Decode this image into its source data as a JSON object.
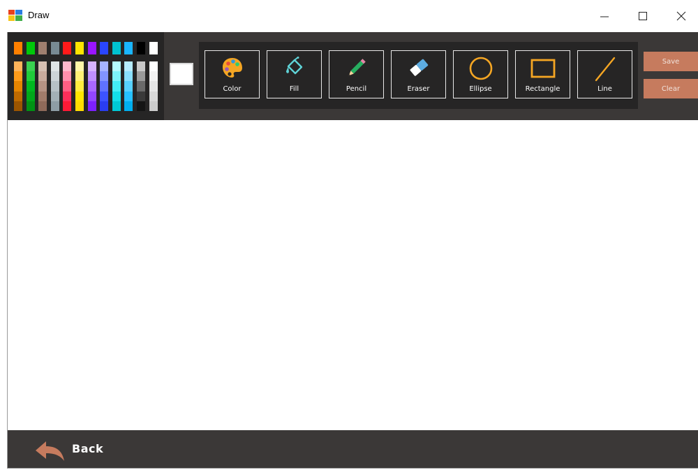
{
  "window": {
    "title": "Draw",
    "icon": "draw-app-icon",
    "controls": [
      "minimize-icon",
      "maximize-icon",
      "close-icon"
    ]
  },
  "palette": {
    "top_colors": [
      "#ff8000",
      "#00c80a",
      "#9f7f6f",
      "#788a93",
      "#ff1a1a",
      "#ffe400",
      "#9a15ff",
      "#2a46ff",
      "#00c2d0",
      "#1ab6ff",
      "#000000",
      "#ffffff"
    ],
    "shade_columns": [
      [
        "#ffb45a",
        "#ff9c1a",
        "#e68500",
        "#bf6a00",
        "#9c5500"
      ],
      [
        "#39d150",
        "#20cc3a",
        "#00b81f",
        "#00a81a",
        "#009214"
      ],
      [
        "#d6bfb2",
        "#c9ab9d",
        "#b69384",
        "#a27c6b",
        "#8f6a5a"
      ],
      [
        "#dfe4e6",
        "#cdd4d8",
        "#b7c1c6",
        "#a3b0b6",
        "#8e9da5"
      ],
      [
        "#ffb8cc",
        "#ff8fad",
        "#ff5f84",
        "#ff2f5a",
        "#ff1a36"
      ],
      [
        "#fff7a8",
        "#fff176",
        "#ffed3f",
        "#ffe600",
        "#ffdc00"
      ],
      [
        "#d6b3ff",
        "#c08fff",
        "#a968ff",
        "#9246ff",
        "#7d20ff"
      ],
      [
        "#a5b3ff",
        "#8294ff",
        "#5f72ff",
        "#3c53ff",
        "#2a3df0"
      ],
      [
        "#b4fbff",
        "#7df4fb",
        "#43ecf5",
        "#14dde9",
        "#00c9d6"
      ],
      [
        "#b6ecff",
        "#8ae0ff",
        "#57d1ff",
        "#26c1ff",
        "#00afef"
      ],
      [
        "#c8c8c8",
        "#9a9a9a",
        "#6a6a6a",
        "#3a3a3a",
        "#151515"
      ],
      [
        "#ffffff",
        "#f2f2f2",
        "#e6e6e6",
        "#d8d8d8",
        "#cccccc"
      ]
    ],
    "current_color": "#ffffff"
  },
  "tools": [
    {
      "label": "Color",
      "icon": "palette-icon"
    },
    {
      "label": "Fill",
      "icon": "fill-bucket-icon"
    },
    {
      "label": "Pencil",
      "icon": "pencil-icon"
    },
    {
      "label": "Eraser",
      "icon": "eraser-icon"
    },
    {
      "label": "Ellipse",
      "icon": "ellipse-icon"
    },
    {
      "label": "Rectangle",
      "icon": "rectangle-icon"
    },
    {
      "label": "Line",
      "icon": "line-icon"
    }
  ],
  "actions": {
    "save_label": "Save",
    "clear_label": "Clear"
  },
  "footer": {
    "back_label": "Back",
    "back_icon": "back-arrow-icon"
  },
  "colors": {
    "toolbar_bg": "#3b3837",
    "panel_bg": "#262525",
    "action_bg": "#c67b5e",
    "shape_accent": "#f5a623"
  }
}
